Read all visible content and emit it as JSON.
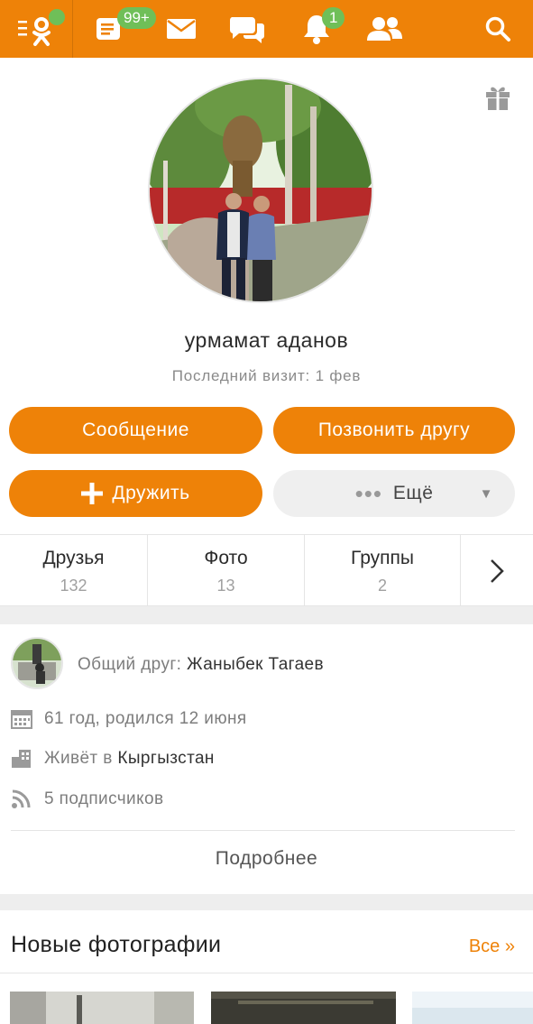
{
  "topbar": {
    "messages_badge": "99+",
    "notifications_badge": "1",
    "colors": {
      "bar": "#ee8208",
      "badge": "#6fbf58"
    }
  },
  "profile": {
    "name": "урмамат аданов",
    "last_visit": "Последний визит: 1 фев"
  },
  "actions": {
    "message": "Сообщение",
    "call": "Позвонить другу",
    "add_friend": "Дружить",
    "more": "Ещё"
  },
  "tabs": [
    {
      "label": "Друзья",
      "count": "132"
    },
    {
      "label": "Фото",
      "count": "13"
    },
    {
      "label": "Группы",
      "count": "2"
    }
  ],
  "info": {
    "mutual_label": "Общий друг:",
    "mutual_name": "Жаныбек Тагаев",
    "age": "61 год, родился 12 июня",
    "lives_label": "Живёт в",
    "lives_place": "Кыргызстан",
    "subscribers": "5 подписчиков",
    "details_link": "Подробнее"
  },
  "photos": {
    "title": "Новые фотографии",
    "all_link": "Все »"
  }
}
